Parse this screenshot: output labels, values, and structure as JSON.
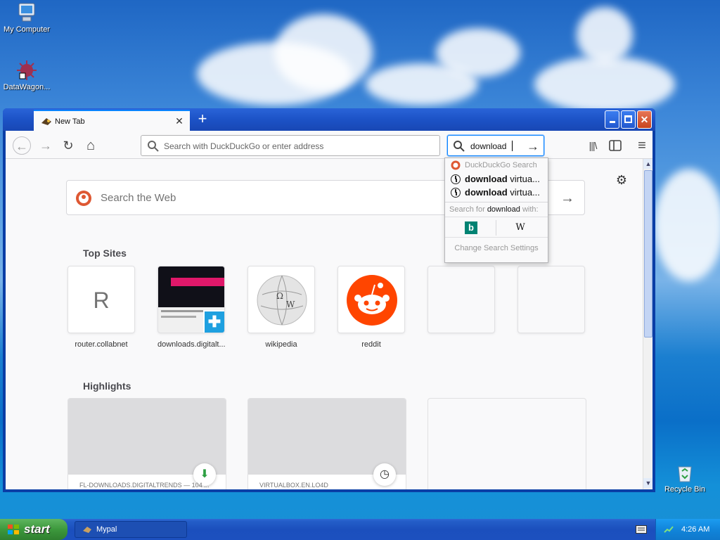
{
  "desktop": {
    "icons": [
      {
        "label": "My Computer"
      },
      {
        "label": "DataWagon..."
      },
      {
        "label": "Recycle Bin"
      }
    ]
  },
  "browser": {
    "tab_title": "New Tab",
    "tab_close": "✕",
    "new_tab": "+",
    "window_buttons": {
      "minimize": "_",
      "maximize": "□",
      "close": "✕"
    },
    "toolbar": {
      "back": "←",
      "forward": "→",
      "reload": "↻",
      "home": "⌂",
      "url_placeholder": "Search with DuckDuckGo or enter address",
      "search_value": "download",
      "search_go": "→",
      "library": "|||\\",
      "sidebar": "▯",
      "menu": "≡"
    },
    "search_dropdown": {
      "header": "DuckDuckGo Search",
      "suggestions": [
        {
          "bold": "download",
          "rest": " virtua..."
        },
        {
          "bold": "download",
          "rest": " virtua..."
        }
      ],
      "search_for_prefix": "Search for ",
      "search_for_term": "download",
      "search_for_suffix": " with:",
      "engines": [
        "b",
        "W"
      ],
      "settings": "Change Search Settings"
    },
    "newtab": {
      "settings_icon": "⚙",
      "search_placeholder": "Search the Web",
      "search_go": "→",
      "top_sites_title": "Top Sites",
      "top_sites": [
        {
          "label": "router.collabnet",
          "letter": "R"
        },
        {
          "label": "downloads.digitalt..."
        },
        {
          "label": "wikipedia"
        },
        {
          "label": "reddit"
        },
        {
          "label": ""
        },
        {
          "label": ""
        }
      ],
      "highlights_title": "Highlights",
      "highlights": [
        {
          "meta": "FL-DOWNLOADS.DIGITALTRENDS — 104 ...",
          "badge": "⬇"
        },
        {
          "meta": "VIRTUALBOX.EN.LO4D",
          "badge": "◷"
        }
      ]
    }
  },
  "taskbar": {
    "start": "start",
    "task": "Mypal",
    "clock": "4:26 AM"
  },
  "colors": {
    "accent": "#0a84ff",
    "xp_title": "#1c52c6",
    "start_green": "#3c983c",
    "reddit": "#ff4500"
  }
}
